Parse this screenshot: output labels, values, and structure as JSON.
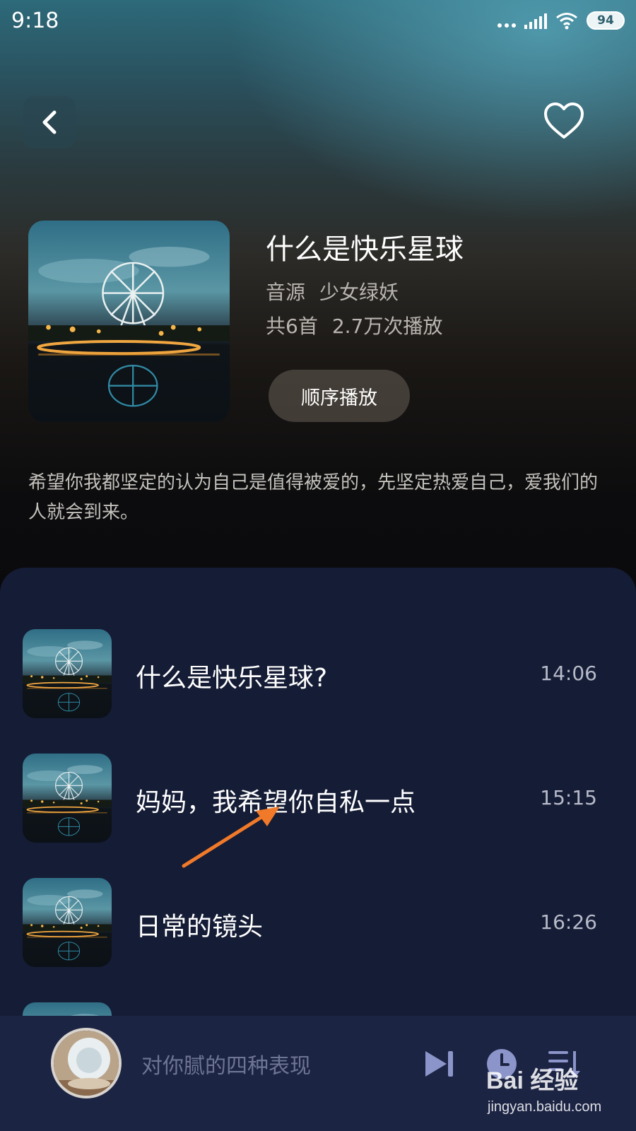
{
  "status_bar": {
    "time": "9:18",
    "battery": "94"
  },
  "nav": {
    "back_icon": "chevron-left-icon",
    "favorite_icon": "heart-icon"
  },
  "album": {
    "title": "什么是快乐星球",
    "source_label": "音源",
    "source_name": "少女绿妖",
    "track_count": "共6首",
    "play_count": "2.7万次播放",
    "play_order_label": "顺序播放",
    "description": "希望你我都坚定的认为自己是值得被爱的，先坚定热爱自己，爱我们的人就会到来。"
  },
  "tracks": [
    {
      "title": "什么是快乐星球?",
      "duration": "14:06"
    },
    {
      "title": "妈妈，我希望你自私一点",
      "duration": "15:15"
    },
    {
      "title": "日常的镜头",
      "duration": "16:26"
    }
  ],
  "mini_player": {
    "title": "对你腻的四种表现",
    "controls": [
      "play-next-icon",
      "clock-icon",
      "playlist-icon"
    ]
  },
  "watermark": {
    "brand": "Bai 经验",
    "url": "jingyan.baidu.com"
  },
  "colors": {
    "accent_arrow": "#f07a2a",
    "panel_bg": "#151c35",
    "player_bg": "#1c2444"
  }
}
